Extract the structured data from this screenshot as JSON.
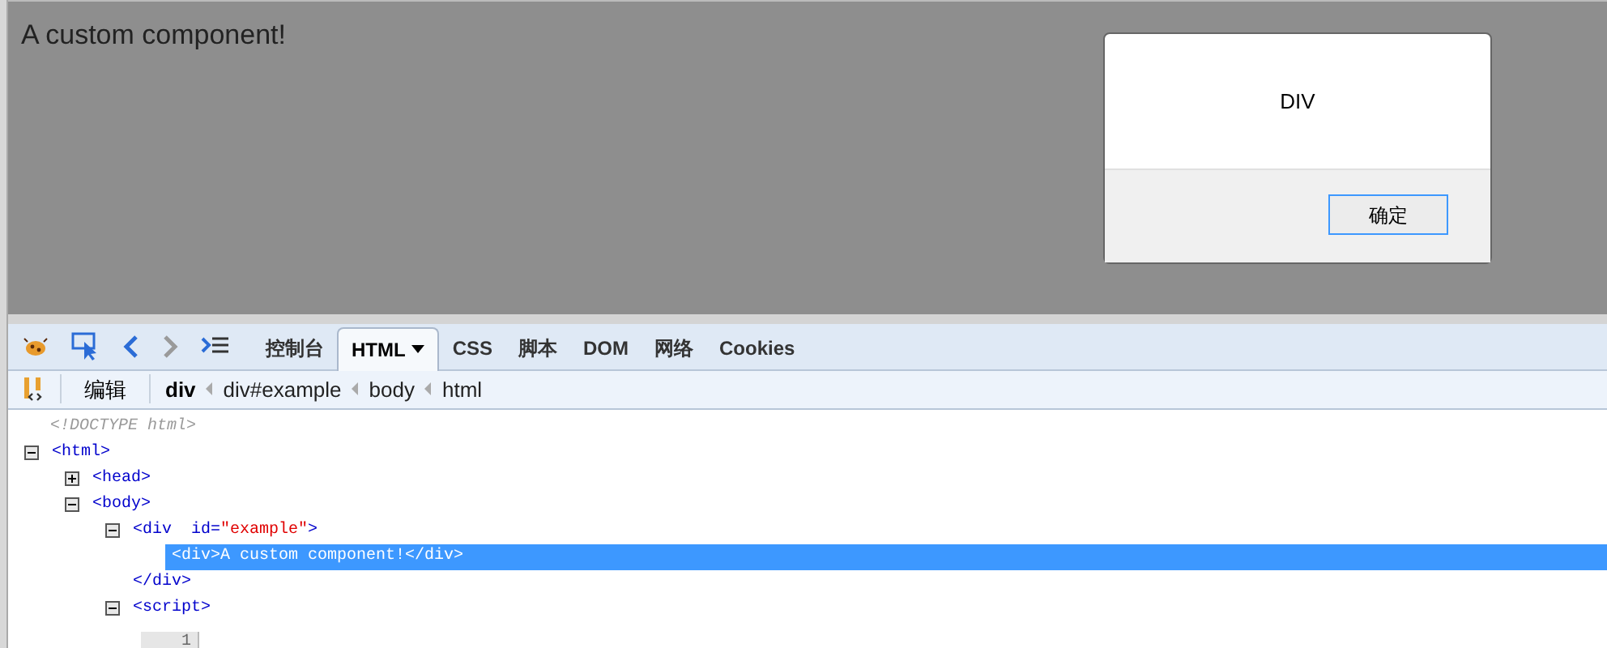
{
  "page": {
    "heading": "A custom component!"
  },
  "dialog": {
    "message": "DIV",
    "button": "确定"
  },
  "toolbar": {
    "tools": [
      {
        "kind": "bug"
      },
      {
        "kind": "inspect"
      },
      {
        "kind": "back"
      },
      {
        "kind": "forward"
      },
      {
        "kind": "console"
      }
    ],
    "tabs": [
      {
        "label": "控制台",
        "selected": false
      },
      {
        "label": "HTML",
        "selected": true,
        "dropdown": true
      },
      {
        "label": "CSS",
        "selected": false
      },
      {
        "label": "脚本",
        "selected": false
      },
      {
        "label": "DOM",
        "selected": false
      },
      {
        "label": "网络",
        "selected": false
      },
      {
        "label": "Cookies",
        "selected": false
      }
    ]
  },
  "breadcrumb": {
    "edit_button": "编辑",
    "items": [
      {
        "label": "div",
        "selected": true
      },
      {
        "label": "div#example",
        "selected": false
      },
      {
        "label": "body",
        "selected": false
      },
      {
        "label": "html",
        "selected": false
      }
    ]
  },
  "tree": [
    {
      "kind": "doctype",
      "text": "<!DOCTYPE html>"
    },
    {
      "kind": "element",
      "tag": "<html>",
      "expanded": true,
      "children": [
        {
          "kind": "element",
          "tag": "<head>",
          "expanded": false
        },
        {
          "kind": "element",
          "tag": "<body>",
          "expanded": true,
          "children": [
            {
              "kind": "element",
              "tag": "<div",
              "attribute": {
                "name": "id=",
                "value": "\"example\""
              },
              "tag_close": ">",
              "expanded": true,
              "end_tag": "</div>",
              "children": [
                {
                  "kind": "inline",
                  "text": "<div>A custom component!</div>",
                  "selected": true
                }
              ]
            },
            {
              "kind": "element",
              "tag": "<script>",
              "expanded": true,
              "children": [
                {
                  "kind": "code",
                  "line_number": "1"
                }
              ]
            }
          ]
        }
      ]
    }
  ]
}
